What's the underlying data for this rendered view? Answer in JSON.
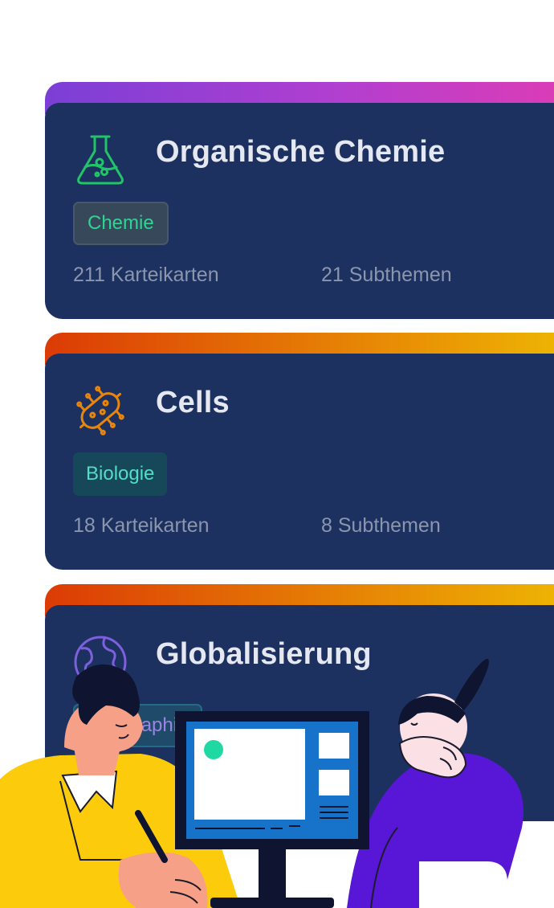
{
  "cards": [
    {
      "title": "Organische Chemie",
      "icon": "flask-icon",
      "tag": "Chemie",
      "flashcards": "211 Karteikarten",
      "subtopics": "21 Subthemen",
      "accent_colors": [
        "#7b3fd6",
        "#de3cb4"
      ]
    },
    {
      "title": "Cells",
      "icon": "bacteria-icon",
      "tag": "Biologie",
      "flashcards": "18 Karteikarten",
      "subtopics": "8 Subthemen",
      "accent_colors": [
        "#dc3b05",
        "#eeb704"
      ]
    },
    {
      "title": "Globalisierung",
      "icon": "globe-icon",
      "tag": "Geographie",
      "accent_colors": [
        "#dc3b05",
        "#eeb704"
      ]
    }
  ],
  "colors": {
    "card_background": "#1c3160",
    "title_text": "#e5e8f1",
    "stat_text": "#8b96ad"
  },
  "illustration": "two-people-at-computer-illustration"
}
